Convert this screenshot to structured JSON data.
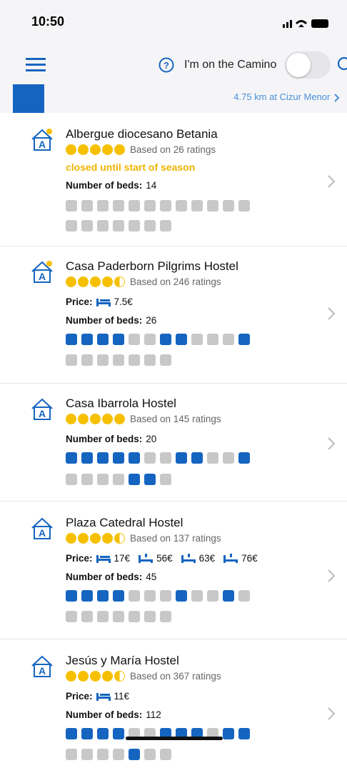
{
  "status": {
    "time": "10:50"
  },
  "header": {
    "camino_label": "I'm on the Camino"
  },
  "location": {
    "text": "4.75 km at Cizur Menor"
  },
  "cards": [
    {
      "name": "Albergue diocesano Betania",
      "rating": 5,
      "rating_text": "Based on 26 ratings",
      "status": "closed until start of season",
      "beds_label": "Number of beds:",
      "beds": "14"
    },
    {
      "name": "Casa Paderborn Pilgrims Hostel",
      "rating": 4.5,
      "rating_text": "Based on 246 ratings",
      "price_label": "Price:",
      "prices": [
        "7.5€"
      ],
      "beds_label": "Number of beds:",
      "beds": "26"
    },
    {
      "name": "Casa Ibarrola Hostel",
      "rating": 5,
      "rating_text": "Based on 145 ratings",
      "beds_label": "Number of beds:",
      "beds": "20"
    },
    {
      "name": "Plaza Catedral Hostel",
      "rating": 4.5,
      "rating_text": "Based on 137 ratings",
      "price_label": "Price:",
      "prices": [
        "17€",
        "56€",
        "63€",
        "76€"
      ],
      "beds_label": "Number of beds:",
      "beds": "45"
    },
    {
      "name": "Jesús y María Hostel",
      "rating": 4.5,
      "rating_text": "Based on 367 ratings",
      "price_label": "Price:",
      "prices": [
        "11€"
      ],
      "beds_label": "Number of beds:",
      "beds": "112"
    }
  ],
  "colors": {
    "accent": "#1565c0",
    "star": "#f6c000",
    "inactive_icon": "#c8c8c8",
    "closed_text": "#f0b400"
  },
  "icons": [
    "washer-icon",
    "dryer-icon",
    "laundry-icon",
    "radiator-icon",
    "lamp-icon",
    "kitchen-icon",
    "coffee-icon",
    "wifi-icon",
    "locker-icon",
    "vending-icon",
    "wheelchair-icon",
    "bicycle-icon",
    "horse-icon",
    "pet-icon",
    "tent-icon",
    "yoga-icon",
    "linen-icon",
    "towel-icon",
    "pool-icon"
  ]
}
